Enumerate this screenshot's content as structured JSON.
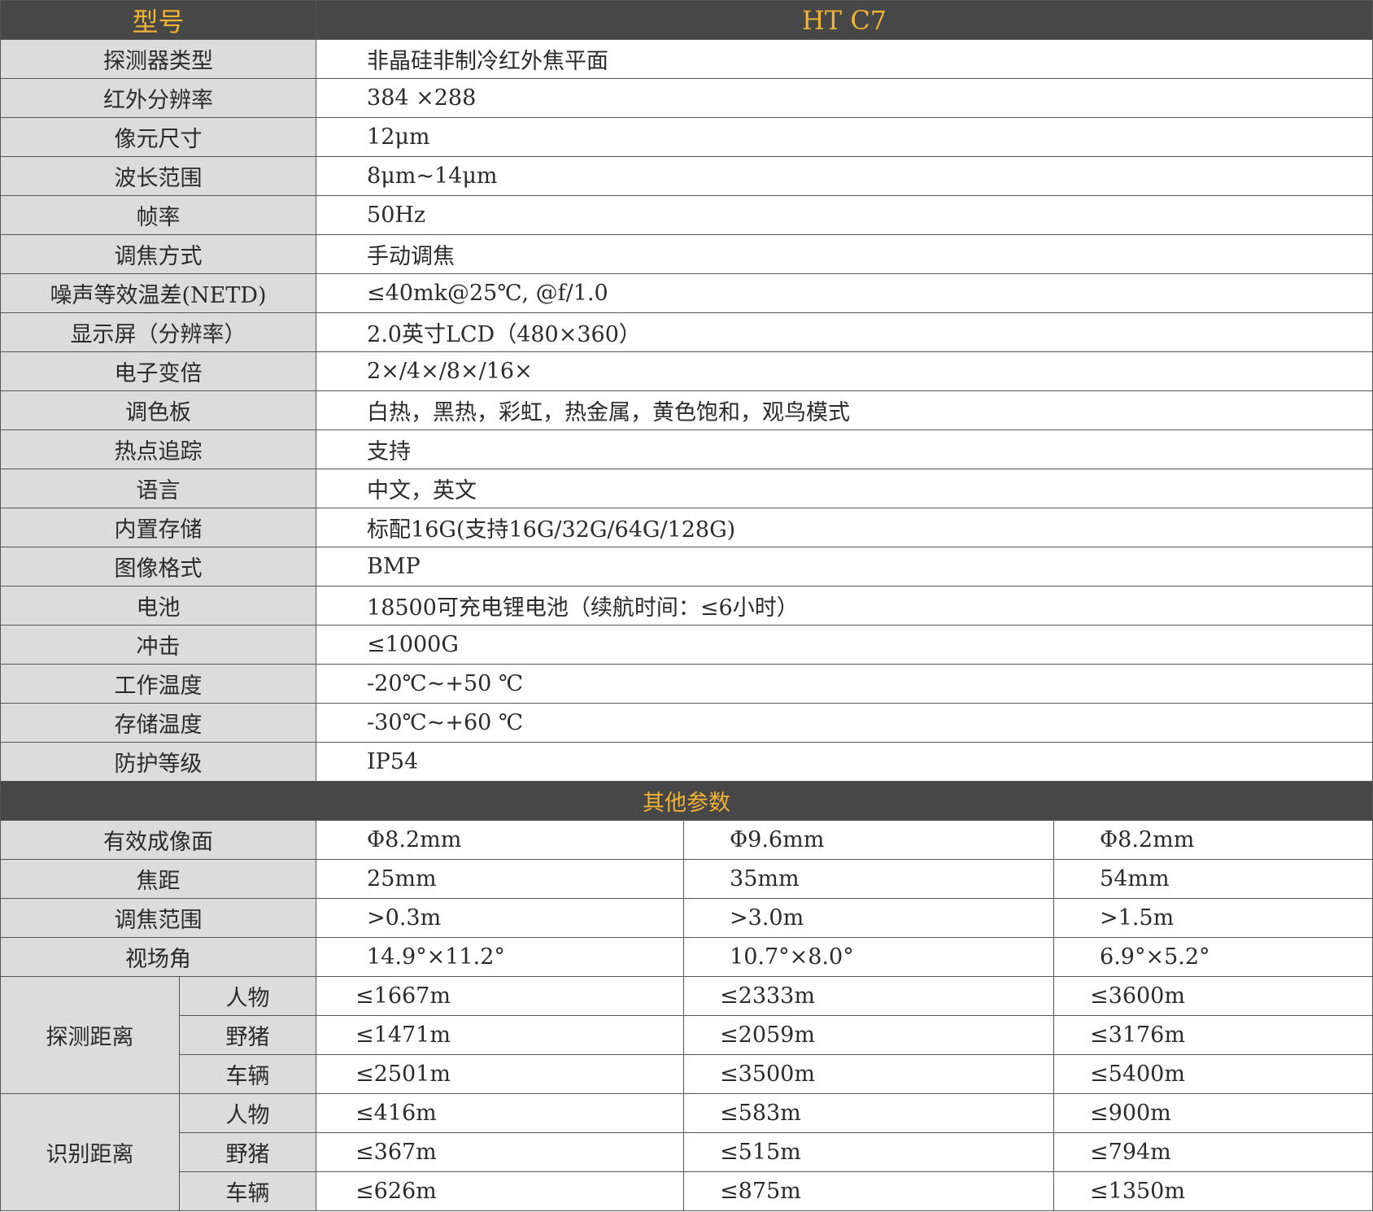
{
  "header": {
    "label": "型号",
    "model": "HT C7"
  },
  "specs": [
    {
      "label": "探测器类型",
      "value": "非晶硅非制冷红外焦平面"
    },
    {
      "label": "红外分辨率",
      "value": "384 ×288"
    },
    {
      "label": "像元尺寸",
      "value": "12μm"
    },
    {
      "label": "波长范围",
      "value": "8μm~14μm"
    },
    {
      "label": "帧率",
      "value": "50Hz"
    },
    {
      "label": "调焦方式",
      "value": "手动调焦"
    },
    {
      "label": "噪声等效温差(NETD)",
      "value": "≤40mk@25℃, @f/1.0"
    },
    {
      "label": "显示屏（分辨率）",
      "value": "2.0英寸LCD（480×360）"
    },
    {
      "label": "电子变倍",
      "value": "2×/4×/8×/16×"
    },
    {
      "label": "调色板",
      "value": "白热，黑热，彩虹，热金属，黄色饱和，观鸟模式"
    },
    {
      "label": "热点追踪",
      "value": "支持"
    },
    {
      "label": "语言",
      "value": "中文，英文"
    },
    {
      "label": "内置存储",
      "value": "标配16G(支持16G/32G/64G/128G)"
    },
    {
      "label": "图像格式",
      "value": "BMP"
    },
    {
      "label": "电池",
      "value": "18500可充电锂电池（续航时间：≤6小时）"
    },
    {
      "label": "冲击",
      "value": "≤1000G"
    },
    {
      "label": "工作温度",
      "value": "-20℃~+50 ℃"
    },
    {
      "label": "存储温度",
      "value": "-30℃~+60 ℃"
    },
    {
      "label": "防护等级",
      "value": "IP54"
    }
  ],
  "other": {
    "title": "其他参数",
    "rows": [
      {
        "label": "有效成像面",
        "values": [
          "Φ8.2mm",
          "Φ9.6mm",
          "Φ8.2mm"
        ]
      },
      {
        "label": "焦距",
        "values": [
          "25mm",
          "35mm",
          "54mm"
        ]
      },
      {
        "label": "调焦范围",
        "values": [
          ">0.3m",
          ">3.0m",
          ">1.5m"
        ]
      },
      {
        "label": "视场角",
        "values": [
          "14.9°×11.2°",
          "10.7°×8.0°",
          "6.9°×5.2°"
        ]
      }
    ],
    "groups": [
      {
        "label": "探测距离",
        "rows": [
          {
            "label": "人物",
            "values": [
              "≤1667m",
              "≤2333m",
              "≤3600m"
            ]
          },
          {
            "label": "野猪",
            "values": [
              "≤1471m",
              "≤2059m",
              "≤3176m"
            ]
          },
          {
            "label": "车辆",
            "values": [
              "≤2501m",
              "≤3500m",
              "≤5400m"
            ]
          }
        ]
      },
      {
        "label": "识别距离",
        "rows": [
          {
            "label": "人物",
            "values": [
              "≤416m",
              "≤583m",
              "≤900m"
            ]
          },
          {
            "label": "野猪",
            "values": [
              "≤367m",
              "≤515m",
              "≤794m"
            ]
          },
          {
            "label": "车辆",
            "values": [
              "≤626m",
              "≤875m",
              "≤1350m"
            ]
          }
        ]
      }
    ]
  }
}
